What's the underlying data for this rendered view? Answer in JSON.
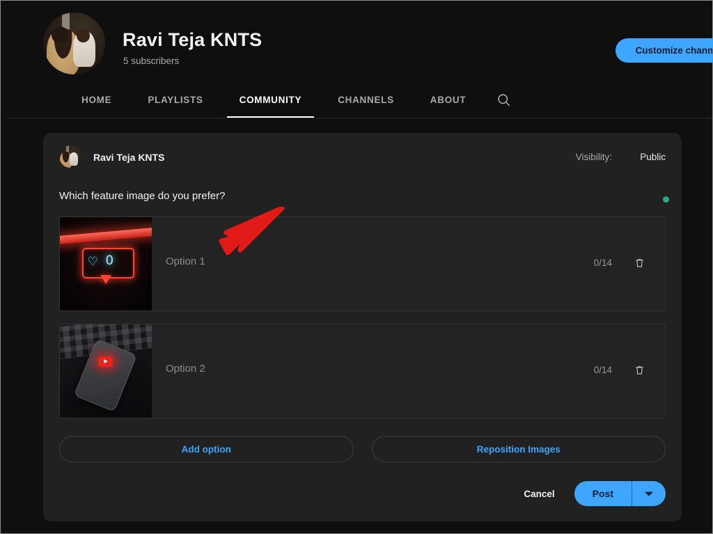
{
  "channel": {
    "name": "Ravi Teja KNTS",
    "subscribers": "5 subscribers",
    "customize_button": "Customize channel",
    "avatar_icon": "channel-avatar-photo"
  },
  "tabs": [
    {
      "label": "HOME",
      "active": false
    },
    {
      "label": "PLAYLISTS",
      "active": false
    },
    {
      "label": "COMMUNITY",
      "active": true
    },
    {
      "label": "CHANNELS",
      "active": false
    },
    {
      "label": "ABOUT",
      "active": false
    }
  ],
  "search_icon": "search-icon",
  "post": {
    "author": "Ravi Teja KNTS",
    "author_avatar_icon": "author-avatar-photo",
    "visibility_label": "Visibility:",
    "visibility_value": "Public",
    "question": "Which feature image do you prefer?",
    "status_dot_color": "#2aa98a",
    "options": [
      {
        "placeholder": "Option 1",
        "counter": "0/14",
        "delete_icon": "trash-icon",
        "thumbnail_icon": "neon-like-sign-image"
      },
      {
        "placeholder": "Option 2",
        "counter": "0/14",
        "delete_icon": "trash-icon",
        "thumbnail_icon": "phone-on-keyboard-image"
      }
    ],
    "add_option_label": "Add option",
    "reposition_label": "Reposition Images",
    "cancel_label": "Cancel",
    "post_label": "Post",
    "post_caret_icon": "chevron-down-icon"
  },
  "annotation": {
    "arrow_icon": "red-arrow-annotation",
    "color": "#e01b17"
  },
  "colors": {
    "accent_blue": "#3ea6ff",
    "page_bg": "#0f0f0f",
    "card_bg": "#212121",
    "row_bg": "#232323"
  }
}
